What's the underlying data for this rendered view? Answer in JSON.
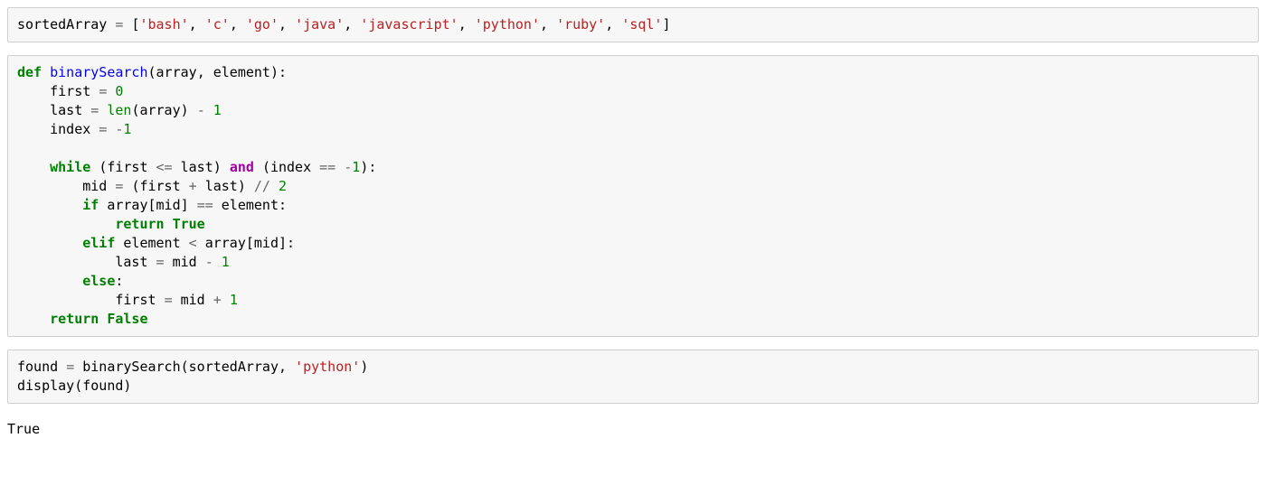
{
  "cell1": {
    "var_sortedArray": "sortedArray",
    "eq": "=",
    "lb": "[",
    "s0": "'bash'",
    "c0": ",",
    "s1": "'c'",
    "c1": ",",
    "s2": "'go'",
    "c2": ",",
    "s3": "'java'",
    "c3": ",",
    "s4": "'javascript'",
    "c4": ",",
    "s5": "'python'",
    "c5": ",",
    "s6": "'ruby'",
    "c6": ",",
    "s7": "'sql'",
    "rb": "]"
  },
  "cell2": {
    "def": "def",
    "fn": "binarySearch",
    "lp1": "(",
    "p_array": "array",
    "cm1": ",",
    "p_element": "element",
    "rp1": ")",
    "col1": ":",
    "first": "first",
    "eq1": "=",
    "n0a": "0",
    "last": "last",
    "eq2": "=",
    "len": "len",
    "lp2": "(",
    "arr2": "array",
    "rp2": ")",
    "minus1": "-",
    "n1a": "1",
    "index": "index",
    "eq3": "=",
    "neg": "-",
    "n1b": "1",
    "while": "while",
    "lp3": "(",
    "first2": "first",
    "le": "<=",
    "last2": "last",
    "rp3": ")",
    "and": "and",
    "lp4": "(",
    "index2": "index",
    "eqeq1": "==",
    "neg2": "-",
    "n1c": "1",
    "rp4": ")",
    "col2": ":",
    "mid": "mid",
    "eq4": "=",
    "lp5": "(",
    "first3": "first",
    "plus1": "+",
    "last3": "last",
    "rp5": ")",
    "floordiv": "//",
    "n2": "2",
    "if": "if",
    "arr3": "array",
    "lbk1": "[",
    "mid2": "mid",
    "rbk1": "]",
    "eqeq2": "==",
    "element2": "element",
    "col3": ":",
    "return1": "return",
    "true": "True",
    "elif": "elif",
    "element3": "element",
    "lt": "<",
    "arr4": "array",
    "lbk2": "[",
    "mid3": "mid",
    "rbk2": "]",
    "col4": ":",
    "last4": "last",
    "eq5": "=",
    "mid4": "mid",
    "minus2": "-",
    "n1d": "1",
    "else": "else",
    "col5": ":",
    "first4": "first",
    "eq6": "=",
    "mid5": "mid",
    "plus2": "+",
    "n1e": "1",
    "return2": "return",
    "false": "False"
  },
  "cell3": {
    "found": "found",
    "eq": "=",
    "call": "binarySearch",
    "lp1": "(",
    "arg1": "sortedArray",
    "cm": ",",
    "arg2": "'python'",
    "rp1": ")",
    "display": "display",
    "lp2": "(",
    "arg3": "found",
    "rp2": ")"
  },
  "output": {
    "text": "True"
  }
}
